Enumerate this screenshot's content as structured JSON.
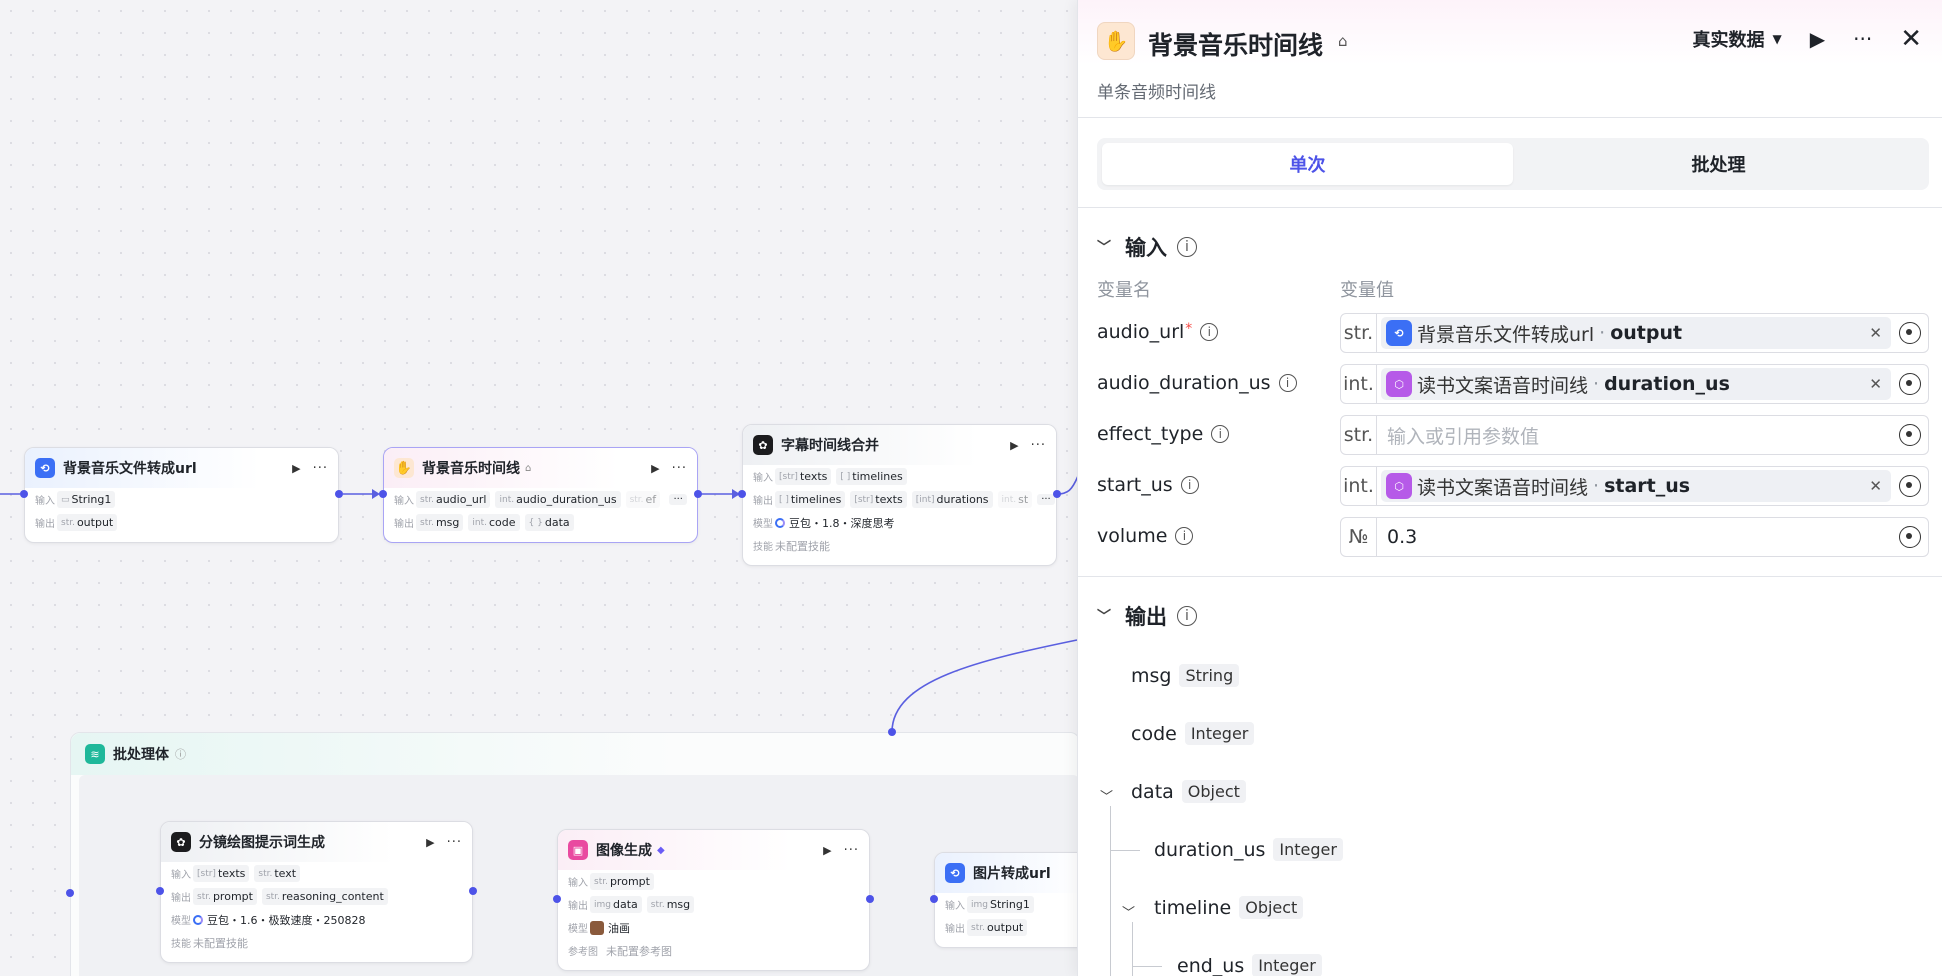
{
  "canvas": {
    "nodes": {
      "bg_music_url": {
        "title": "背景音乐文件转成url",
        "input_label": "输入",
        "output_label": "输出",
        "inputs": [
          {
            "type": "",
            "name": "String1",
            "icon": "folder"
          }
        ],
        "outputs": [
          {
            "type": "str.",
            "name": "output"
          }
        ]
      },
      "bg_music_timeline": {
        "title": "背景音乐时间线",
        "input_label": "输入",
        "output_label": "输出",
        "inputs": [
          {
            "type": "str.",
            "name": "audio_url"
          },
          {
            "type": "int.",
            "name": "audio_duration_us"
          },
          {
            "type": "str.",
            "name": "ef"
          }
        ],
        "outputs": [
          {
            "type": "str.",
            "name": "msg"
          },
          {
            "type": "int.",
            "name": "code"
          },
          {
            "type": "{ }",
            "name": "data"
          }
        ],
        "more": "···"
      },
      "subtitle_merge": {
        "title": "字幕时间线合并",
        "input_label": "输入",
        "output_label": "输出",
        "model_label": "模型",
        "skill_label": "技能",
        "inputs": [
          {
            "type": "[str]",
            "name": "texts"
          },
          {
            "type": "[ ]",
            "name": "timelines"
          }
        ],
        "outputs": [
          {
            "type": "[ ]",
            "name": "timelines"
          },
          {
            "type": "[str]",
            "name": "texts"
          },
          {
            "type": "[int]",
            "name": "durations"
          },
          {
            "type": "int.",
            "name": "st"
          }
        ],
        "model": "豆包・1.8・深度思考",
        "skill": "未配置技能",
        "more": "···"
      },
      "storyboard_prompt": {
        "title": "分镜绘图提示词生成",
        "input_label": "输入",
        "output_label": "输出",
        "model_label": "模型",
        "skill_label": "技能",
        "inputs": [
          {
            "type": "[str]",
            "name": "texts"
          },
          {
            "type": "str.",
            "name": "text"
          }
        ],
        "outputs": [
          {
            "type": "str.",
            "name": "prompt"
          },
          {
            "type": "str.",
            "name": "reasoning_content"
          }
        ],
        "model": "豆包・1.6・极致速度・250828",
        "skill": "未配置技能"
      },
      "image_gen": {
        "title": "图像生成",
        "input_label": "输入",
        "output_label": "输出",
        "model_label": "模型",
        "ref_label": "参考图",
        "inputs": [
          {
            "type": "str.",
            "name": "prompt"
          }
        ],
        "outputs": [
          {
            "type": "img",
            "name": "data"
          },
          {
            "type": "str.",
            "name": "msg"
          }
        ],
        "model": "油画",
        "ref": "未配置参考图"
      },
      "image_url": {
        "title": "图片转成url",
        "input_label": "输入",
        "output_label": "输出",
        "inputs": [
          {
            "type": "img",
            "name": "String1"
          }
        ],
        "outputs": [
          {
            "type": "str.",
            "name": "output"
          }
        ]
      }
    },
    "group": {
      "title": "批处理体"
    }
  },
  "panel": {
    "title": "背景音乐时间线",
    "subtitle": "单条音频时间线",
    "mode": "真实数据",
    "tabs": [
      {
        "label": "单次",
        "active": true
      },
      {
        "label": "批处理",
        "active": false
      }
    ],
    "input_section": {
      "title": "输入",
      "col_name": "变量名",
      "col_value": "变量值",
      "vars": [
        {
          "name": "audio_url",
          "required": true,
          "type": "str.",
          "kind": "ref",
          "ref_icon": "blue",
          "ref_node": "背景音乐文件转成url",
          "ref_field": "output"
        },
        {
          "name": "audio_duration_us",
          "required": false,
          "type": "int.",
          "kind": "ref",
          "ref_icon": "purple",
          "ref_node": "读书文案语音时间线",
          "ref_field": "duration_us"
        },
        {
          "name": "effect_type",
          "required": false,
          "type": "str.",
          "kind": "placeholder",
          "placeholder": "输入或引用参数值"
        },
        {
          "name": "start_us",
          "required": false,
          "type": "int.",
          "kind": "ref",
          "ref_icon": "purple",
          "ref_node": "读书文案语音时间线",
          "ref_field": "start_us"
        },
        {
          "name": "volume",
          "required": false,
          "type": "№",
          "kind": "value",
          "value": "0.3"
        }
      ]
    },
    "output_section": {
      "title": "输出",
      "fields": [
        {
          "name": "msg",
          "type": "String"
        },
        {
          "name": "code",
          "type": "Integer"
        },
        {
          "name": "data",
          "type": "Object"
        },
        {
          "name": "duration_us",
          "type": "Integer"
        },
        {
          "name": "timeline",
          "type": "Object"
        },
        {
          "name": "end_us",
          "type": "Integer"
        }
      ]
    }
  },
  "colors": {
    "accent": "#4d53e8",
    "edge": "#5a5fe0",
    "required": "#f54a45"
  }
}
